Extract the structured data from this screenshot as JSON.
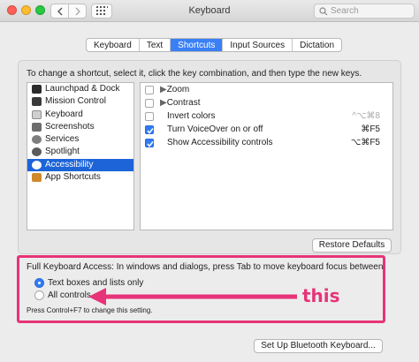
{
  "window": {
    "title": "Keyboard"
  },
  "search": {
    "placeholder": "Search"
  },
  "tabs": [
    {
      "label": "Keyboard",
      "active": false
    },
    {
      "label": "Text",
      "active": false
    },
    {
      "label": "Shortcuts",
      "active": true
    },
    {
      "label": "Input Sources",
      "active": false
    },
    {
      "label": "Dictation",
      "active": false
    }
  ],
  "instructions": "To change a shortcut, select it, click the key combination, and then type the new keys.",
  "categories": [
    {
      "label": "Launchpad & Dock",
      "icon": "launchpad-icon",
      "color": "#2b2b2b",
      "selected": false
    },
    {
      "label": "Mission Control",
      "icon": "mission-control-icon",
      "color": "#3a3a3a",
      "selected": false
    },
    {
      "label": "Keyboard",
      "icon": "keyboard-icon",
      "color": "#8e8e8e",
      "selected": false
    },
    {
      "label": "Screenshots",
      "icon": "screenshots-icon",
      "color": "#6d6d6d",
      "selected": false
    },
    {
      "label": "Services",
      "icon": "services-gear-icon",
      "color": "#7d7d7d",
      "selected": false
    },
    {
      "label": "Spotlight",
      "icon": "spotlight-icon",
      "color": "#5b5b5b",
      "selected": false
    },
    {
      "label": "Accessibility",
      "icon": "accessibility-icon",
      "color": "#1a73e8",
      "selected": true
    },
    {
      "label": "App Shortcuts",
      "icon": "app-shortcuts-icon",
      "color": "#d08a2b",
      "selected": false
    }
  ],
  "shortcuts": [
    {
      "label": "Zoom",
      "checked": false,
      "expandable": true,
      "key": ""
    },
    {
      "label": "Contrast",
      "checked": false,
      "expandable": true,
      "key": ""
    },
    {
      "label": "Invert colors",
      "checked": false,
      "expandable": false,
      "key": "^⌥⌘8",
      "dim": true
    },
    {
      "label": "Turn VoiceOver on or off",
      "checked": true,
      "expandable": false,
      "key": "⌘F5"
    },
    {
      "label": "Show Accessibility controls",
      "checked": true,
      "expandable": false,
      "key": "⌥⌘F5"
    }
  ],
  "restore_button": "Restore Defaults",
  "keyboard_access": {
    "label": "Full Keyboard Access: In windows and dialogs, press Tab to move keyboard focus between:",
    "options": [
      {
        "label": "Text boxes and lists only",
        "selected": true
      },
      {
        "label": "All controls",
        "selected": false
      }
    ],
    "hint": "Press Control+F7 to change this setting."
  },
  "bluetooth_button": "Set Up Bluetooth Keyboard...",
  "annotation": {
    "text": "this",
    "color": "#e73378"
  }
}
